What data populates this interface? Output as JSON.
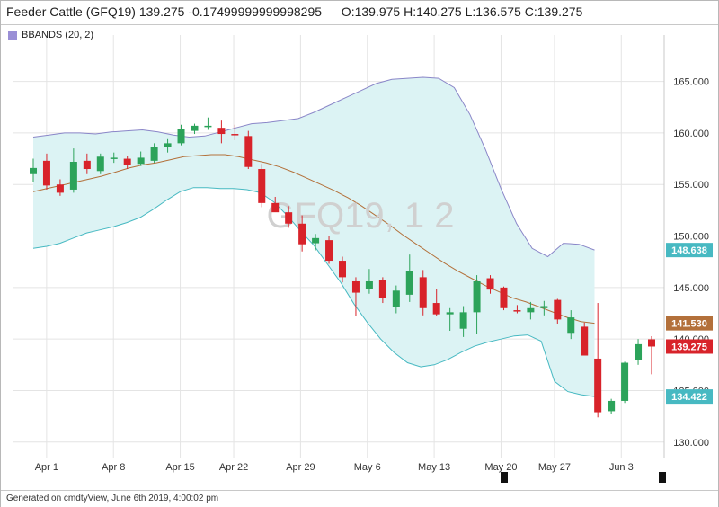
{
  "header": {
    "title": "Feeder Cattle (GFQ19) 139.275 -0.17499999999998295 — O:139.975 H:140.275 L:136.575 C:139.275"
  },
  "legend": {
    "label": "BBANDS (20, 2)",
    "color": "#9a8fd6"
  },
  "watermark": "GFQ19, 1 2",
  "footer": {
    "text": "Generated on cmdtyView, June 6th 2019, 4:00:02 pm"
  },
  "colors": {
    "up": "#2ca35a",
    "down": "#d8232a",
    "band_fill": "#dcf3f4",
    "upper_band": "#8a86c8",
    "lower_band": "#47b9c2",
    "middle_band": "#b3703a"
  },
  "badges": [
    {
      "label": "148.638",
      "value": 148.638,
      "color": "#47b9c2"
    },
    {
      "label": "141.530",
      "value": 141.53,
      "color": "#b3703a"
    },
    {
      "label": "139.275",
      "value": 139.275,
      "color": "#d8232a"
    },
    {
      "label": "134.422",
      "value": 134.422,
      "color": "#47b9c2"
    }
  ],
  "chart_data": {
    "type": "candlestick",
    "ylim": [
      128.5,
      169.5
    ],
    "y_ticks": [
      130,
      135,
      140,
      145,
      150,
      155,
      160,
      165
    ],
    "y_tick_labels": [
      "130.000",
      "135.000",
      "140.000",
      "145.000",
      "150.000",
      "155.000",
      "160.000",
      "165.000"
    ],
    "x_ticks": [
      {
        "label": "Apr 1",
        "index": 1
      },
      {
        "label": "Apr 8",
        "index": 6
      },
      {
        "label": "Apr 15",
        "index": 11
      },
      {
        "label": "Apr 22",
        "index": 15
      },
      {
        "label": "Apr 29",
        "index": 20
      },
      {
        "label": "May 6",
        "index": 25
      },
      {
        "label": "May 13",
        "index": 30
      },
      {
        "label": "May 20",
        "index": 35
      },
      {
        "label": "May 27",
        "index": 39
      },
      {
        "label": "Jun 3",
        "index": 44
      }
    ],
    "candles": [
      {
        "o": 156.0,
        "h": 157.5,
        "l": 155.2,
        "c": 156.6
      },
      {
        "o": 157.3,
        "h": 158.0,
        "l": 154.5,
        "c": 154.9
      },
      {
        "o": 155.0,
        "h": 155.5,
        "l": 153.9,
        "c": 154.2
      },
      {
        "o": 154.5,
        "h": 158.5,
        "l": 154.2,
        "c": 157.2
      },
      {
        "o": 157.3,
        "h": 158.0,
        "l": 156.0,
        "c": 156.5
      },
      {
        "o": 156.3,
        "h": 158.0,
        "l": 156.0,
        "c": 157.7
      },
      {
        "o": 157.6,
        "h": 158.1,
        "l": 157.1,
        "c": 157.6
      },
      {
        "o": 157.5,
        "h": 157.8,
        "l": 156.5,
        "c": 156.9
      },
      {
        "o": 157.0,
        "h": 158.2,
        "l": 156.8,
        "c": 157.6
      },
      {
        "o": 157.3,
        "h": 159.0,
        "l": 157.1,
        "c": 158.6
      },
      {
        "o": 158.6,
        "h": 159.4,
        "l": 158.1,
        "c": 159.0
      },
      {
        "o": 159.0,
        "h": 160.8,
        "l": 158.8,
        "c": 160.4
      },
      {
        "o": 160.2,
        "h": 160.9,
        "l": 159.9,
        "c": 160.7
      },
      {
        "o": 160.6,
        "h": 161.5,
        "l": 160.3,
        "c": 160.7
      },
      {
        "o": 160.5,
        "h": 161.2,
        "l": 159.0,
        "c": 159.9
      },
      {
        "o": 159.9,
        "h": 160.8,
        "l": 159.3,
        "c": 159.8
      },
      {
        "o": 159.7,
        "h": 160.2,
        "l": 156.5,
        "c": 156.7
      },
      {
        "o": 156.5,
        "h": 157.0,
        "l": 152.8,
        "c": 153.2
      },
      {
        "o": 153.2,
        "h": 153.8,
        "l": 152.6,
        "c": 152.3
      },
      {
        "o": 152.3,
        "h": 152.9,
        "l": 150.8,
        "c": 151.2
      },
      {
        "o": 151.2,
        "h": 152.0,
        "l": 148.5,
        "c": 149.2
      },
      {
        "o": 149.3,
        "h": 150.2,
        "l": 148.6,
        "c": 149.8
      },
      {
        "o": 149.6,
        "h": 150.0,
        "l": 147.3,
        "c": 147.6
      },
      {
        "o": 147.6,
        "h": 148.0,
        "l": 145.5,
        "c": 146.0
      },
      {
        "o": 145.6,
        "h": 146.0,
        "l": 142.2,
        "c": 144.5
      },
      {
        "o": 144.9,
        "h": 146.8,
        "l": 144.4,
        "c": 145.6
      },
      {
        "o": 145.7,
        "h": 146.0,
        "l": 143.5,
        "c": 144.0
      },
      {
        "o": 143.1,
        "h": 145.2,
        "l": 142.5,
        "c": 144.7
      },
      {
        "o": 144.3,
        "h": 148.2,
        "l": 143.6,
        "c": 146.6
      },
      {
        "o": 146.0,
        "h": 146.7,
        "l": 142.3,
        "c": 143.0
      },
      {
        "o": 143.5,
        "h": 144.9,
        "l": 142.2,
        "c": 142.4
      },
      {
        "o": 142.4,
        "h": 143.0,
        "l": 140.8,
        "c": 142.6
      },
      {
        "o": 141.0,
        "h": 143.2,
        "l": 140.2,
        "c": 142.6
      },
      {
        "o": 142.6,
        "h": 146.2,
        "l": 140.5,
        "c": 145.6
      },
      {
        "o": 145.9,
        "h": 146.2,
        "l": 144.4,
        "c": 144.8
      },
      {
        "o": 145.0,
        "h": 145.1,
        "l": 142.8,
        "c": 143.0
      },
      {
        "o": 142.8,
        "h": 143.3,
        "l": 142.5,
        "c": 142.7
      },
      {
        "o": 142.6,
        "h": 143.6,
        "l": 141.9,
        "c": 143.0
      },
      {
        "o": 143.0,
        "h": 143.7,
        "l": 142.3,
        "c": 143.2
      },
      {
        "o": 143.8,
        "h": 143.9,
        "l": 141.5,
        "c": 141.9
      },
      {
        "o": 140.6,
        "h": 142.8,
        "l": 140.0,
        "c": 142.1
      },
      {
        "o": 141.2,
        "h": 141.6,
        "l": 138.5,
        "c": 138.4
      },
      {
        "o": 138.1,
        "h": 143.5,
        "l": 132.4,
        "c": 132.9
      },
      {
        "o": 133.0,
        "h": 134.2,
        "l": 132.7,
        "c": 134.0
      },
      {
        "o": 134.0,
        "h": 137.8,
        "l": 133.8,
        "c": 137.7
      },
      {
        "o": 138.0,
        "h": 140.0,
        "l": 137.5,
        "c": 139.5
      },
      {
        "o": 139.975,
        "h": 140.275,
        "l": 136.575,
        "c": 139.275
      }
    ],
    "upper_band": [
      159.6,
      159.8,
      160.0,
      160.0,
      159.9,
      160.1,
      160.2,
      160.3,
      160.1,
      159.8,
      159.6,
      159.7,
      160.1,
      160.5,
      160.9,
      161.0,
      161.2,
      161.4,
      162.0,
      162.7,
      163.4,
      164.1,
      164.8,
      165.2,
      165.3,
      165.4,
      165.3,
      164.4,
      161.8,
      158.4,
      154.6,
      151.2,
      148.8,
      148.0,
      149.3,
      149.2,
      148.638
    ],
    "middle_band": [
      154.3,
      154.6,
      154.9,
      155.2,
      155.5,
      155.8,
      156.2,
      156.6,
      156.9,
      157.1,
      157.4,
      157.7,
      157.8,
      157.9,
      157.9,
      157.7,
      157.4,
      157.1,
      156.7,
      156.2,
      155.6,
      155.0,
      154.4,
      153.7,
      152.9,
      152.0,
      151.1,
      150.1,
      149.2,
      148.3,
      147.4,
      146.6,
      145.9,
      145.2,
      144.6,
      144.0,
      143.6,
      143.1,
      142.6,
      142.1,
      141.7,
      141.53
    ],
    "lower_band": [
      148.8,
      149.0,
      149.3,
      149.8,
      150.3,
      150.6,
      150.9,
      151.3,
      151.8,
      152.6,
      153.5,
      154.3,
      154.7,
      154.7,
      154.6,
      154.6,
      154.5,
      154.2,
      153.3,
      152.0,
      150.5,
      149.1,
      147.3,
      145.5,
      143.4,
      141.6,
      140.0,
      138.7,
      137.7,
      137.3,
      137.5,
      138.0,
      138.7,
      139.3,
      139.7,
      140.0,
      140.3,
      140.4,
      139.8,
      135.9,
      134.9,
      134.6,
      134.422
    ],
    "upper_band_x": [
      0,
      1,
      2,
      3,
      4,
      5,
      6,
      7,
      8,
      9,
      10,
      11,
      12,
      13,
      14,
      15,
      16,
      17,
      18,
      19,
      20,
      21,
      22,
      23,
      24,
      25,
      26,
      27,
      28,
      29,
      30,
      31,
      32,
      33,
      34,
      35,
      36
    ],
    "xlabel": "",
    "ylabel": ""
  }
}
